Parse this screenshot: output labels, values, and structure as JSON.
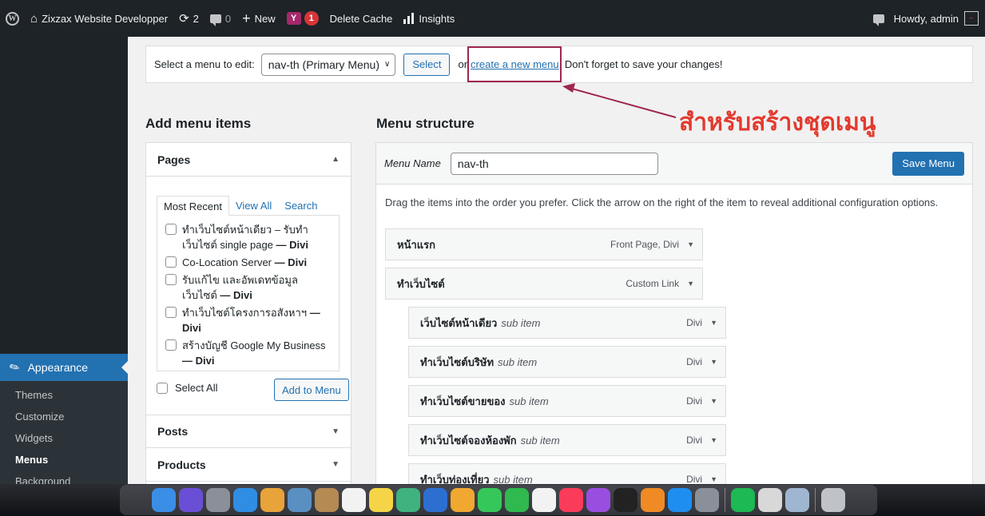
{
  "adminbar": {
    "site_name": "Zixzax Website Developper",
    "updates_count": "2",
    "comments_count": "0",
    "new_label": "New",
    "yoast_label": "Y",
    "yoast_badge": "1",
    "delete_cache": "Delete Cache",
    "insights": "Insights",
    "howdy": "Howdy, admin"
  },
  "sidebar": {
    "appearance": "Appearance",
    "submenu": [
      "Themes",
      "Customize",
      "Widgets",
      "Menus",
      "Background"
    ],
    "current": "Menus"
  },
  "manage": {
    "select_label": "Select a menu to edit:",
    "selected_menu": "nav-th (Primary Menu)",
    "select_button": "Select",
    "or_text": "or",
    "create_link": "create a new menu",
    "save_notice": ". Don't forget to save your changes!"
  },
  "annotation": {
    "text": "สำหรับสร้างชุดเมนู",
    "color": "#e33a2e",
    "box_color": "#a0284f"
  },
  "left": {
    "title": "Add menu items",
    "pages_heading": "Pages",
    "tabs": [
      "Most Recent",
      "View All",
      "Search"
    ],
    "pages": [
      {
        "title": "ทำเว็บไซต์หน้าเดียว – รับทำเว็บไซต์ single page",
        "suffix": " — Divi"
      },
      {
        "title": "Co-Location Server",
        "suffix": " — Divi"
      },
      {
        "title": "รับแก้ไข และอัพเดทข้อมูลเว็บไซต์",
        "suffix": " — Divi"
      },
      {
        "title": "ทำเว็บไซต์โครงการอสังหาฯ",
        "suffix": " — Divi"
      },
      {
        "title": "สร้างบัญชี Google My Business",
        "suffix": " — Divi"
      }
    ],
    "select_all": "Select All",
    "add_to_menu": "Add to Menu",
    "posts_heading": "Posts",
    "products_heading": "Products"
  },
  "right": {
    "title": "Menu structure",
    "menu_name_label": "Menu Name",
    "menu_name_value": "nav-th",
    "save_button": "Save Menu",
    "instructions": "Drag the items into the order you prefer. Click the arrow on the right of the item to reveal additional configuration options.",
    "items": [
      {
        "title": "หน้าแรก",
        "sub": "",
        "type": "Front Page, Divi"
      },
      {
        "title": "ทำเว็บไซต์",
        "sub": "",
        "type": "Custom Link"
      },
      {
        "title": "เว็บไซต์หน้าเดียว",
        "sub": "sub item",
        "type": "Divi"
      },
      {
        "title": "ทำเว็บไซต์บริษัท",
        "sub": "sub item",
        "type": "Divi"
      },
      {
        "title": "ทำเว็บไซต์ขายของ",
        "sub": "sub item",
        "type": "Divi"
      },
      {
        "title": "ทำเว็บไซต์จองห้องพัก",
        "sub": "sub item",
        "type": "Divi"
      },
      {
        "title": "ทำเว็บท่องเที่ยว",
        "sub": "sub item",
        "type": "Divi"
      }
    ]
  },
  "dock": {
    "icons": [
      {
        "name": "finder-icon",
        "color": "#3a8ee6"
      },
      {
        "name": "siri-icon",
        "color": "#6a4fd6"
      },
      {
        "name": "launchpad-icon",
        "color": "#8a8f99"
      },
      {
        "name": "safari-icon",
        "color": "#2f8de4"
      },
      {
        "name": "chrome-icon",
        "color": "#e8a33a"
      },
      {
        "name": "preview-icon",
        "color": "#5a8fc2"
      },
      {
        "name": "contacts-icon",
        "color": "#b58a53"
      },
      {
        "name": "calendar-icon",
        "color": "#f2f2f2"
      },
      {
        "name": "notes-icon",
        "color": "#f5d547"
      },
      {
        "name": "atom-icon",
        "color": "#3fb27f"
      },
      {
        "name": "sourcetree-icon",
        "color": "#2d6fd1"
      },
      {
        "name": "photos-icon",
        "color": "#f0a830"
      },
      {
        "name": "messages-icon",
        "color": "#35c759"
      },
      {
        "name": "facetime-icon",
        "color": "#2fb94f"
      },
      {
        "name": "reminders-icon",
        "color": "#f2f2f2"
      },
      {
        "name": "music-icon",
        "color": "#fa3c5a"
      },
      {
        "name": "podcasts-icon",
        "color": "#9a4ee0"
      },
      {
        "name": "appletv-icon",
        "color": "#222222"
      },
      {
        "name": "books-icon",
        "color": "#f08a24"
      },
      {
        "name": "appstore-icon",
        "color": "#1e8ef0"
      },
      {
        "name": "system-preferences-icon",
        "color": "#8a8f99"
      },
      {
        "name": "spotify-icon",
        "color": "#1db954"
      },
      {
        "name": "screenshot-icon",
        "color": "#d8d8d8"
      },
      {
        "name": "finder-window-icon",
        "color": "#9fb6d0"
      },
      {
        "name": "trash-icon",
        "color": "#bfc3c8"
      }
    ]
  }
}
